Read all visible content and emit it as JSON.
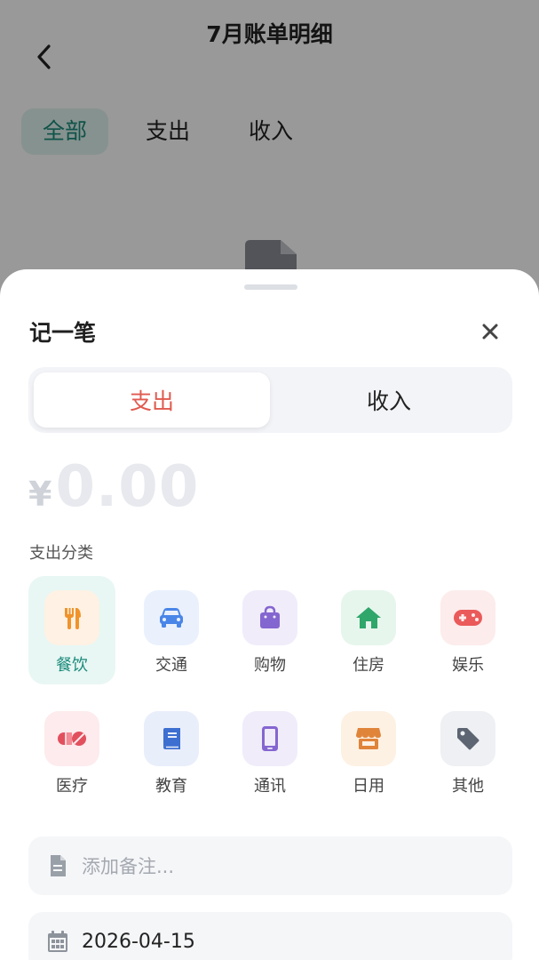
{
  "background_page": {
    "title": "7月账单明细",
    "tabs": [
      {
        "label": "全部",
        "active": true
      },
      {
        "label": "支出",
        "active": false
      },
      {
        "label": "收入",
        "active": false
      }
    ]
  },
  "sheet": {
    "title": "记一笔",
    "type_toggle": {
      "expense_label": "支出",
      "income_label": "收入",
      "selected": "支出"
    },
    "amount": {
      "currency": "¥",
      "value": "0.00"
    },
    "category_section_label": "支出分类",
    "categories": [
      {
        "name": "餐饮",
        "icon": "utensils-icon",
        "color": "#f0932b",
        "bg": "#fff1e3",
        "selected": true
      },
      {
        "name": "交通",
        "icon": "car-icon",
        "color": "#4a86e8",
        "bg": "#eaf1fd",
        "selected": false
      },
      {
        "name": "购物",
        "icon": "shopping-bag-icon",
        "color": "#8466d0",
        "bg": "#f0ecfa",
        "selected": false
      },
      {
        "name": "住房",
        "icon": "house-icon",
        "color": "#2fa66a",
        "bg": "#e6f6ec",
        "selected": false
      },
      {
        "name": "娱乐",
        "icon": "gamepad-icon",
        "color": "#ea5a5a",
        "bg": "#fdecec",
        "selected": false
      },
      {
        "name": "医疗",
        "icon": "pills-icon",
        "color": "#e2505e",
        "bg": "#fdebed",
        "selected": false
      },
      {
        "name": "教育",
        "icon": "book-icon",
        "color": "#3c6fd0",
        "bg": "#e9eefb",
        "selected": false
      },
      {
        "name": "通讯",
        "icon": "phone-icon",
        "color": "#8466d0",
        "bg": "#f0ecfa",
        "selected": false
      },
      {
        "name": "日用",
        "icon": "store-icon",
        "color": "#e0843a",
        "bg": "#fdf1e4",
        "selected": false
      },
      {
        "name": "其他",
        "icon": "tag-icon",
        "color": "#5d6472",
        "bg": "#eef0f3",
        "selected": false
      }
    ],
    "note_placeholder": "添加备注...",
    "date_value": "2026-04-15"
  },
  "colors": {
    "accent": "#1a8a7a",
    "expense_red": "#e05a4f"
  }
}
